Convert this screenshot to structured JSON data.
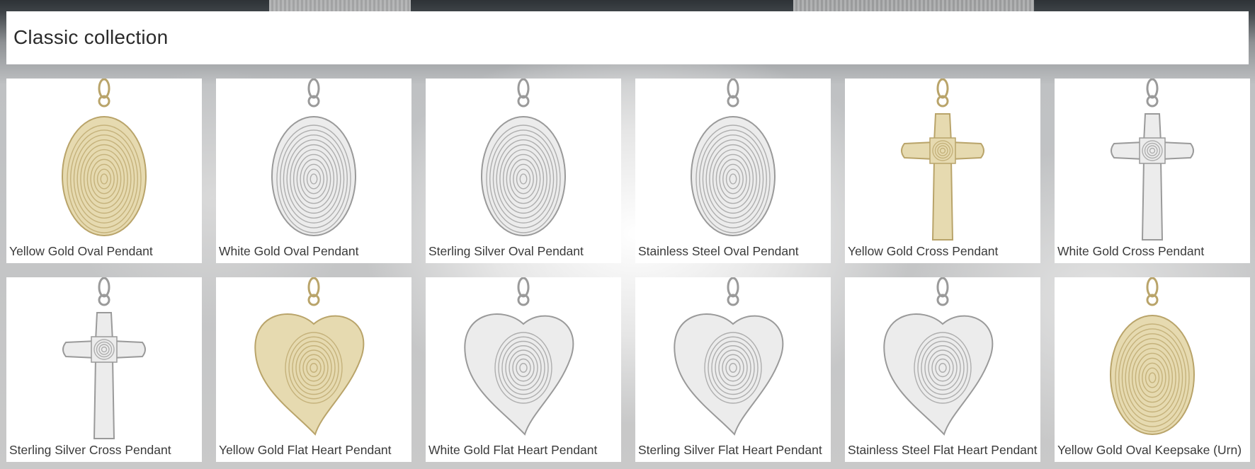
{
  "collection": {
    "title": "Classic collection"
  },
  "products": [
    {
      "name": "Yellow Gold Oval Pendant",
      "shape": "oval",
      "metal": "yellow"
    },
    {
      "name": "White Gold Oval Pendant",
      "shape": "oval",
      "metal": "white"
    },
    {
      "name": "Sterling Silver Oval Pendant",
      "shape": "oval",
      "metal": "white"
    },
    {
      "name": "Stainless Steel Oval Pendant",
      "shape": "oval",
      "metal": "white"
    },
    {
      "name": "Yellow Gold Cross Pendant",
      "shape": "cross",
      "metal": "yellow"
    },
    {
      "name": "White Gold Cross Pendant",
      "shape": "cross",
      "metal": "white"
    },
    {
      "name": "Sterling Silver Cross Pendant",
      "shape": "cross",
      "metal": "white"
    },
    {
      "name": "Yellow Gold Flat Heart Pendant",
      "shape": "heart",
      "metal": "yellow"
    },
    {
      "name": "White Gold Flat Heart Pendant",
      "shape": "heart",
      "metal": "white"
    },
    {
      "name": "Sterling Silver Flat Heart Pendant",
      "shape": "heart",
      "metal": "white"
    },
    {
      "name": "Stainless Steel Flat Heart Pendant",
      "shape": "heart",
      "metal": "white"
    },
    {
      "name": "Yellow Gold Oval Keepsake (Urn)",
      "shape": "oval",
      "metal": "yellow"
    }
  ],
  "colors": {
    "yellow_fill": "#e6dab0",
    "yellow_line": "#b9a46a",
    "white_fill": "#ececec",
    "white_line": "#9a9a9a"
  }
}
